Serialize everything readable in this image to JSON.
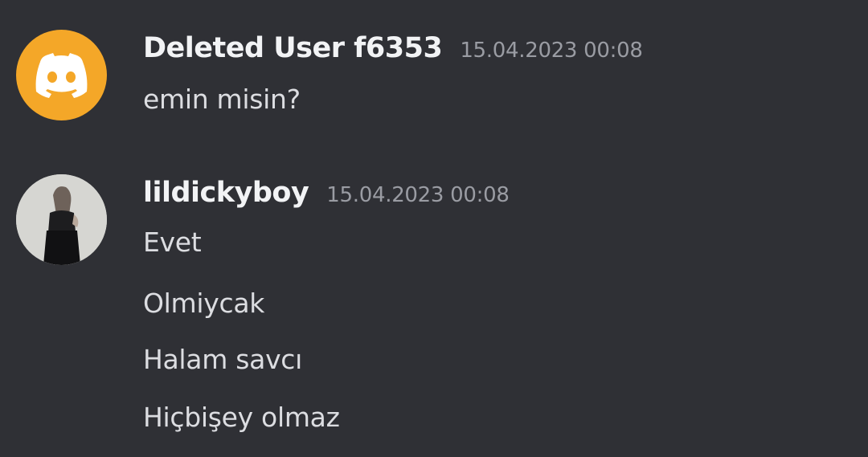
{
  "messages": [
    {
      "username": "Deleted User f6353",
      "timestamp": "15.04.2023 00:08",
      "avatar": "discord-default-avatar",
      "avatar_color": "#f4a728",
      "lines": [
        "emin misin?"
      ]
    },
    {
      "username": "lildickyboy",
      "timestamp": "15.04.2023 00:08",
      "avatar": "user-photo-avatar",
      "lines": [
        "Evet",
        "Olmiycak",
        "Halam savcı",
        "Hiçbişey olmaz"
      ]
    }
  ],
  "colors": {
    "background": "#2f3035",
    "username": "#f2f3f5",
    "timestamp": "#9a9ca3",
    "message_text": "#dcdde1"
  }
}
